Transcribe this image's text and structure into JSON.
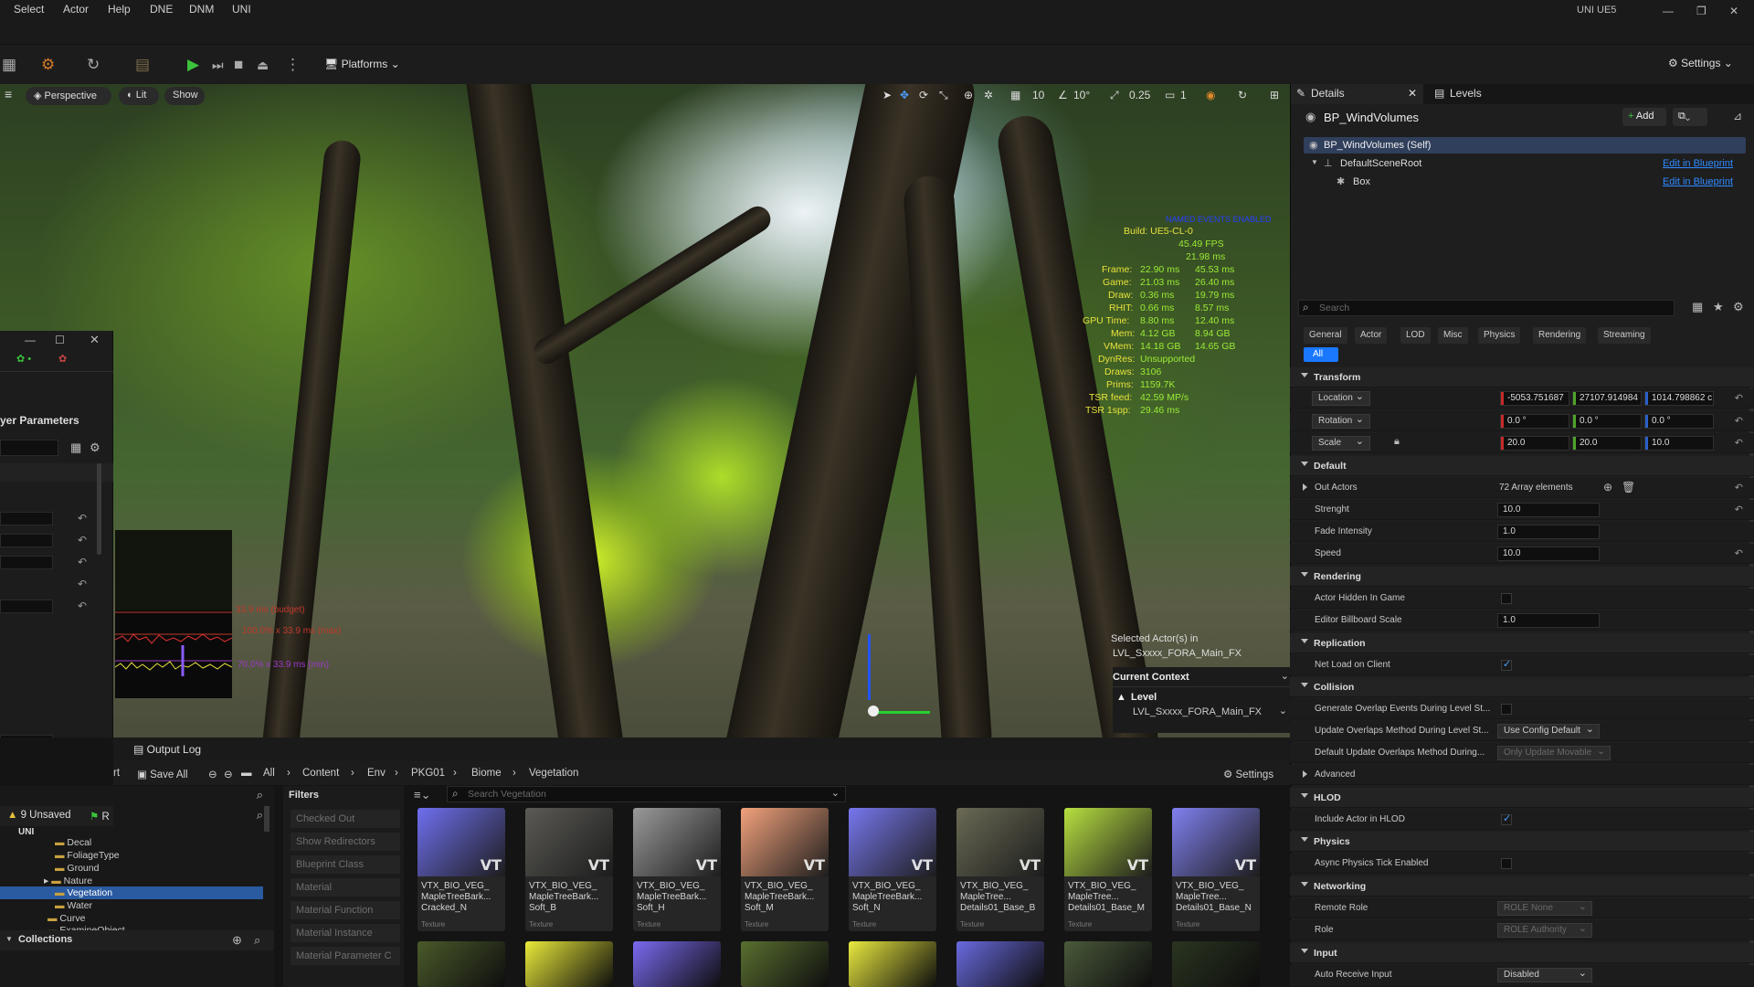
{
  "menu": [
    "Select",
    "Actor",
    "Help",
    "DNE",
    "DNM",
    "UNI"
  ],
  "project_name": "UNI UE5",
  "toolbar": {
    "platforms": "Platforms",
    "settings": "Settings"
  },
  "viewport": {
    "perspective": "Perspective",
    "lit": "Lit",
    "show": "Show",
    "snap_grid": "10",
    "snap_rot": "10°",
    "snap_scale": "0.25",
    "cam_speed": "1",
    "stats_header": "NAMED EVENTS ENABLED",
    "build": "Build: UE5-CL-0",
    "fps": "45.49 FPS",
    "ms": "21.98 ms",
    "stats": [
      {
        "label": "Frame:",
        "v1": "22.90 ms",
        "v2": "45.53 ms"
      },
      {
        "label": "Game:",
        "v1": "21.03 ms",
        "v2": "26.40 ms"
      },
      {
        "label": "Draw:",
        "v1": "0.36 ms",
        "v2": "19.79 ms"
      },
      {
        "label": "RHIT:",
        "v1": "0.66 ms",
        "v2": "8.57 ms"
      },
      {
        "label": "GPU Time:",
        "v1": "8.80 ms",
        "v2": "12.40 ms"
      },
      {
        "label": "Mem:",
        "v1": "4.12 GB",
        "v2": "8.94 GB"
      },
      {
        "label": "VMem:",
        "v1": "14.18 GB",
        "v2": "14.65 GB"
      },
      {
        "label": "DynRes:",
        "v1": "Unsupported",
        "v2": ""
      },
      {
        "label": "Draws:",
        "v1": "3106",
        "v2": ""
      },
      {
        "label": "Prims:",
        "v1": "1159.7K",
        "v2": ""
      },
      {
        "label": "TSR feed:",
        "v1": "42.59 MP/s",
        "v2": ""
      },
      {
        "label": "TSR 1spp:",
        "v1": "29.46 ms",
        "v2": ""
      }
    ],
    "budget_lines": [
      "33.9 ms (budget)",
      "100.0% x 33.9 ms (max)",
      "70.0% x 33.9 ms (min)"
    ],
    "selected_actors": "Selected Actor(s) in",
    "selected_level": "LVL_Sxxxx_FORA_Main_FX",
    "current_context": "Current Context",
    "level_label": "Level",
    "level_value": "LVL_Sxxxx_FORA_Main_FX"
  },
  "left_panel": {
    "title": "yer Parameters"
  },
  "content_browser": {
    "output_log": "Output Log",
    "import_partial": "rt",
    "save_all": "Save All",
    "breadcrumbs": [
      "All",
      "Content",
      "Env",
      "PKG01",
      "Biome",
      "Vegetation"
    ],
    "settings": "Settings",
    "unsaved": "9 Unsaved",
    "revision_partial": "R",
    "filters_title": "Filters",
    "filters": [
      "Checked Out",
      "Show Redirectors",
      "Blueprint Class",
      "Material",
      "Material Function",
      "Material Instance",
      "Material Parameter C"
    ],
    "search_placeholder": "Search Vegetation",
    "tree_root": "UNI",
    "tree": [
      "Decal",
      "FoliageType",
      "Ground",
      "Nature",
      "Vegetation",
      "Water",
      "Curve",
      "ExamineObject"
    ],
    "collections": "Collections",
    "assets": [
      {
        "name": "VTX_BIO_VEG_ MapleTreeBark... Cracked_N",
        "type": "Texture",
        "badge": "VT",
        "color": "#6f6ff0"
      },
      {
        "name": "VTX_BIO_VEG_ MapleTreeBark... Soft_B",
        "type": "Texture",
        "badge": "VT",
        "color": "#5b5a55"
      },
      {
        "name": "VTX_BIO_VEG_ MapleTreeBark... Soft_H",
        "type": "Texture",
        "badge": "VT",
        "color": "#9a9a9a"
      },
      {
        "name": "VTX_BIO_VEG_ MapleTreeBark... Soft_M",
        "type": "Texture",
        "badge": "VT",
        "color": "#f3a27c"
      },
      {
        "name": "VTX_BIO_VEG_ MapleTreeBark... Soft_N",
        "type": "Texture",
        "badge": "VT",
        "color": "#7777ee"
      },
      {
        "name": "VTX_BIO_VEG_ MapleTree... Details01_Base_B",
        "type": "Texture",
        "badge": "VT",
        "color": "#6a6a55"
      },
      {
        "name": "VTX_BIO_VEG_ MapleTree... Details01_Base_M",
        "type": "Texture",
        "badge": "VT",
        "color": "#b8e040"
      },
      {
        "name": "VTX_BIO_VEG_ MapleTree... Details01_Base_N",
        "type": "Texture",
        "badge": "VT",
        "color": "#8080f0"
      }
    ],
    "row2_colors": [
      "#4a5a2a",
      "#eaea3a",
      "#7a6af0",
      "#5a7030",
      "#eaea40",
      "#6a6ae0",
      "#4a5a3a",
      "#2a3520"
    ]
  },
  "details": {
    "tab_details": "Details",
    "tab_levels": "Levels",
    "actor_name": "BP_WindVolumes",
    "add": "Add",
    "components": [
      {
        "label": "BP_WindVolumes (Self)",
        "link": ""
      },
      {
        "label": "DefaultSceneRoot",
        "link": "Edit in Blueprint"
      },
      {
        "label": "Box",
        "link": "Edit in Blueprint"
      }
    ],
    "search_placeholder": "Search",
    "categories": [
      "General",
      "Actor",
      "LOD",
      "Misc",
      "Physics",
      "Rendering",
      "Streaming"
    ],
    "all": "All",
    "transform": {
      "title": "Transform",
      "location": {
        "label": "Location",
        "x": "-5053.751687",
        "y": "27107.914984",
        "z": "1014.798862 c"
      },
      "rotation": {
        "label": "Rotation",
        "x": "0.0 °",
        "y": "0.0 °",
        "z": "0.0 °"
      },
      "scale": {
        "label": "Scale",
        "x": "20.0",
        "y": "20.0",
        "z": "10.0"
      }
    },
    "default": {
      "title": "Default",
      "out_actors": "Out Actors",
      "out_actors_val": "72 Array elements",
      "strenght": "Strenght",
      "strenght_val": "10.0",
      "fade": "Fade Intensity",
      "fade_val": "1.0",
      "speed": "Speed",
      "speed_val": "10.0"
    },
    "rendering": {
      "title": "Rendering",
      "hidden": "Actor Hidden In Game",
      "hidden_val": false,
      "billboard": "Editor Billboard Scale",
      "billboard_val": "1.0"
    },
    "replication": {
      "title": "Replication",
      "net_load": "Net Load on Client",
      "net_load_val": true
    },
    "collision": {
      "title": "Collision",
      "gen_overlap": "Generate Overlap Events During Level St...",
      "gen_overlap_val": false,
      "update_overlap": "Update Overlaps Method During Level St...",
      "update_overlap_val": "Use Config Default",
      "default_update": "Default Update Overlaps Method During...",
      "default_update_val": "Only Update Movable"
    },
    "advanced": "Advanced",
    "hlod": {
      "title": "HLOD",
      "include": "Include Actor in HLOD",
      "include_val": true
    },
    "physics": {
      "title": "Physics",
      "async": "Async Physics Tick Enabled",
      "async_val": false
    },
    "networking": {
      "title": "Networking",
      "remote_role": "Remote Role",
      "remote_role_val": "ROLE None",
      "role": "Role",
      "role_val": "ROLE Authority"
    },
    "input": {
      "title": "Input",
      "auto": "Auto Receive Input",
      "auto_val": "Disabled"
    }
  }
}
